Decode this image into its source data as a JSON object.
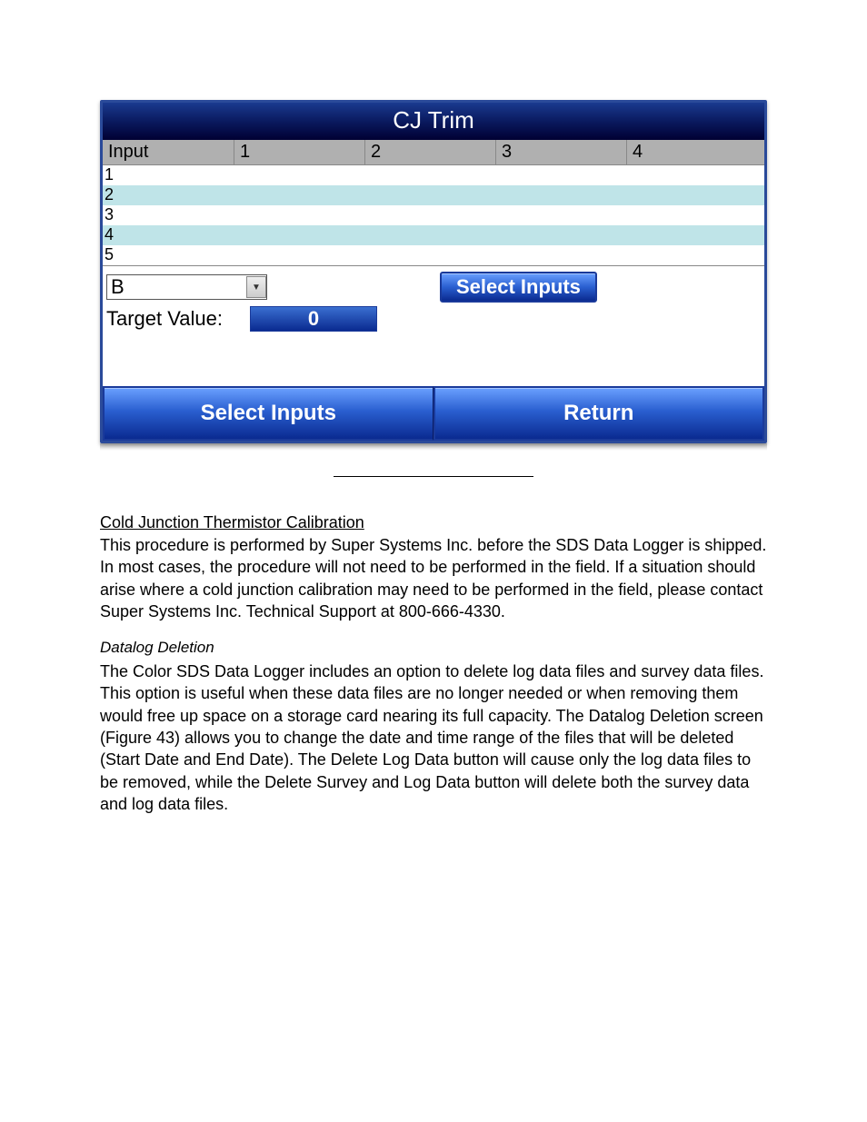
{
  "screen": {
    "title": "CJ Trim",
    "headers": {
      "input": "Input",
      "c1": "1",
      "c2": "2",
      "c3": "3",
      "c4": "4"
    },
    "rows": [
      "1",
      "2",
      "3",
      "4",
      "5"
    ],
    "dropdown_value": "B",
    "select_inputs_btn": "Select Inputs",
    "target_label": "Target Value:",
    "target_value": "0",
    "bottom_left": "Select Inputs",
    "bottom_right": "Return"
  },
  "doc": {
    "heading1": "Cold Junction Thermistor Calibration",
    "para1": "This procedure is performed by Super Systems Inc. before the SDS Data Logger is shipped. In most cases, the procedure will not need to be performed in the field. If a situation should arise where a cold junction calibration may need to be performed in the field, please contact Super Systems Inc. Technical Support at 800-666-4330.",
    "heading2": "Datalog Deletion",
    "para2": "The Color SDS Data Logger includes an option to delete log data files and survey data files. This option is useful when these data files are no longer needed or when removing them would free up space on a storage card nearing its full capacity. The Datalog Deletion screen (Figure 43) allows you to change the date and time range of the files that will be deleted (Start Date and End Date). The Delete Log Data button will cause only the log data files to be removed, while the Delete Survey and Log Data button will delete both the survey data and log data files."
  }
}
